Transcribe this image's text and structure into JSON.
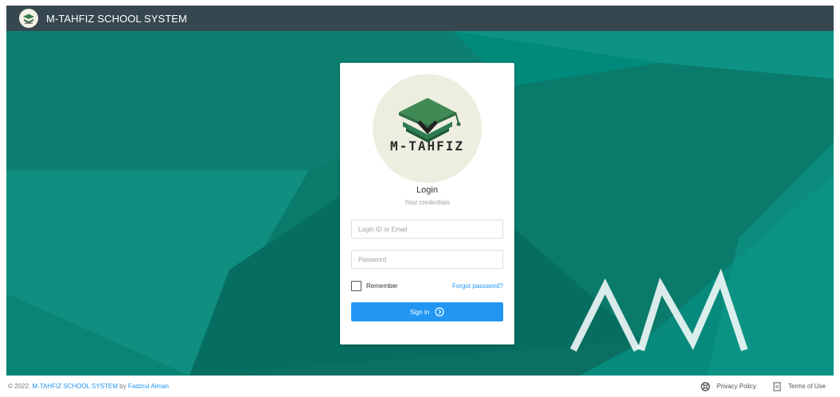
{
  "app": {
    "title": "M-TAHFIZ SCHOOL SYSTEM",
    "logo_icon": "graduation-cap-book-icon",
    "logo_text": "M-TAHFIZ"
  },
  "login": {
    "heading": "Login",
    "subheading": "Your credentials",
    "login_id_placeholder": "Login ID or Email",
    "login_id_value": "",
    "password_placeholder": "Password",
    "password_value": "",
    "remember_label": "Remember",
    "remember_checked": false,
    "forgot_label": "Forgot password?",
    "signin_label": "Sign in",
    "signin_icon": "chevron-circle-right-icon"
  },
  "footer": {
    "prefix": "© 2022.",
    "system_link": "M-TAHFIZ SCHOOL SYSTEM",
    "by": "by",
    "author_link": "Fadzrul Aiman",
    "privacy_label": "Privacy Policy",
    "privacy_icon": "lifebuoy-icon",
    "terms_label": "Terms of Use",
    "terms_icon": "document-icon"
  },
  "colors": {
    "topbar": "#37474f",
    "background_teal": "#00897b",
    "accent_blue": "#2196f3",
    "logo_green": "#2e7d4f"
  }
}
